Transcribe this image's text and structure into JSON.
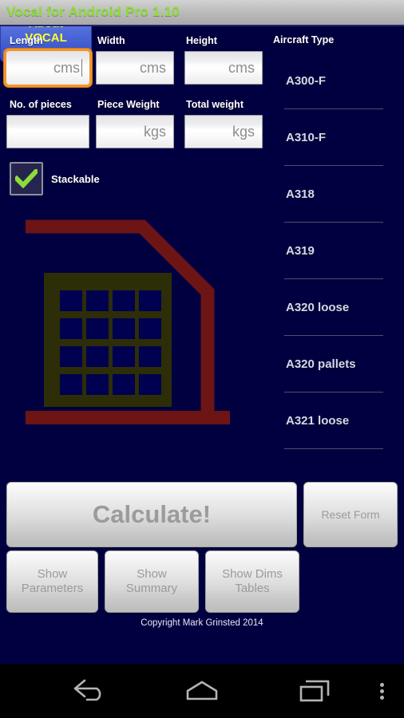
{
  "titlebar": {
    "title": "Vocal for Android Pro 1.10"
  },
  "form": {
    "fields": [
      {
        "label": "Length",
        "placeholder": "cms",
        "value": "",
        "focused": true
      },
      {
        "label": "Width",
        "placeholder": "cms",
        "value": "",
        "focused": false
      },
      {
        "label": "Height",
        "placeholder": "cms",
        "value": "",
        "focused": false
      },
      {
        "label": "No. of pieces",
        "placeholder": "",
        "value": "",
        "focused": false
      },
      {
        "label": "Piece Weight",
        "placeholder": "kgs",
        "value": "",
        "focused": false
      },
      {
        "label": "Total weight",
        "placeholder": "kgs",
        "value": "",
        "focused": false
      }
    ],
    "stackable": {
      "label": "Stackable",
      "checked": true
    }
  },
  "aircraft": {
    "header": "Aircraft Type",
    "items": [
      {
        "label": "A300-F"
      },
      {
        "label": "A310-F"
      },
      {
        "label": "A318"
      },
      {
        "label": "A319"
      },
      {
        "label": "A320 loose"
      },
      {
        "label": "A320 pallets"
      },
      {
        "label": "A321 loose"
      }
    ]
  },
  "diagram": {
    "name": "cargo-container-diagram",
    "grid_rows": 4,
    "grid_cols": 4,
    "outline_color": "#6d1414",
    "block_color": "#2d2d08",
    "cell_color": "#000050"
  },
  "buttons": {
    "calculate": "Calculate!",
    "reset": "Reset Form",
    "show_parameters": "Show\nParameters",
    "show_summary": "Show\nSummary",
    "show_dims_tables": "Show Dims\nTables",
    "about": "About\nVOCAL"
  },
  "footer": {
    "copyright": "Copyright Mark Grinsted 2014"
  },
  "navbar": {
    "back": "back-icon",
    "home": "home-icon",
    "recents": "recents-icon",
    "menu": "overflow-menu-icon"
  },
  "colors": {
    "background": "#000040",
    "title_text": "#8ddd38",
    "accent_focus": "#f2952c",
    "about_text": "#ffff22",
    "check_green": "#8ddd38"
  }
}
